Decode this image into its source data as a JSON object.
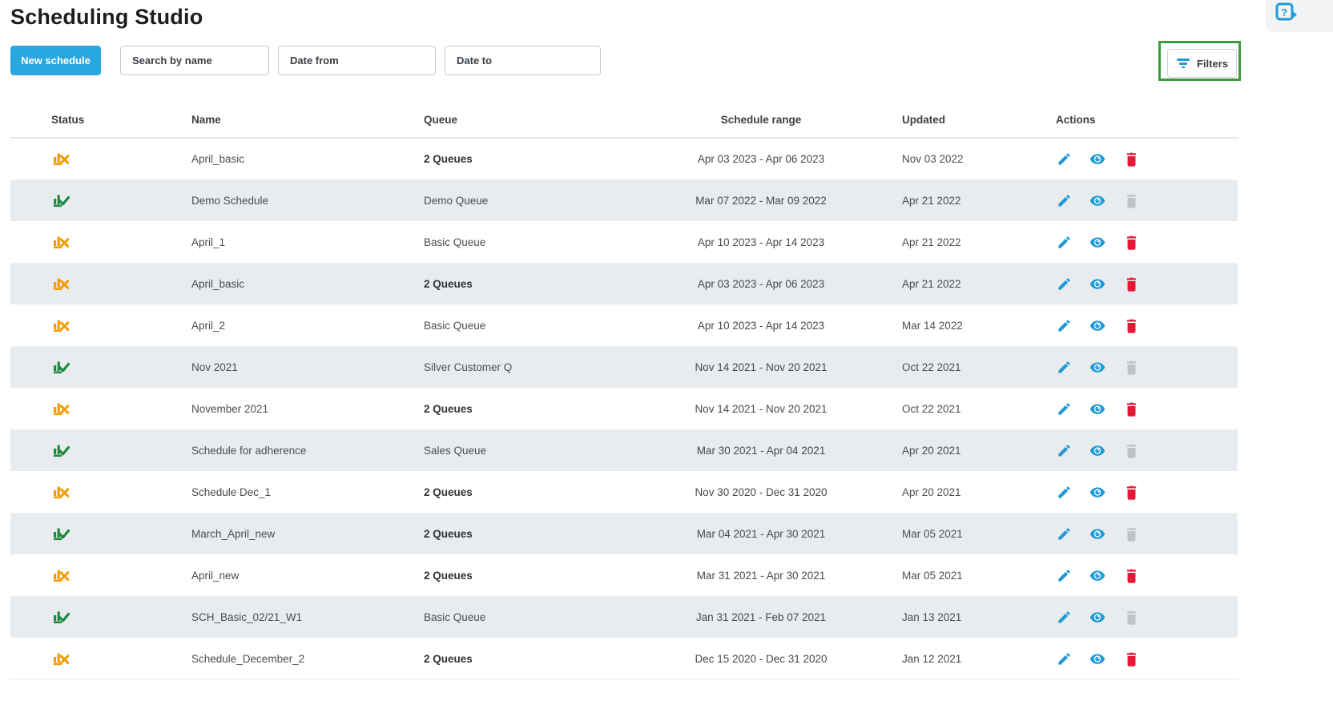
{
  "page": {
    "title": "Scheduling Studio"
  },
  "toolbar": {
    "new_schedule_label": "New schedule",
    "search_placeholder": "Search by name",
    "date_from_placeholder": "Date from",
    "date_to_placeholder": "Date to",
    "filters_label": "Filters"
  },
  "icons": {
    "help": "help-question-bubble-icon",
    "filter": "filter-lines-icon",
    "edit": "pencil-icon",
    "view": "eye-icon",
    "delete": "trash-icon",
    "status_published": "chart-check-icon",
    "status_unpublished": "chart-x-icon"
  },
  "colors": {
    "accent_blue": "#2BA7E0",
    "icon_blue": "#1F9AD7",
    "danger_red": "#E51937",
    "disabled_gray": "#BDC3C7",
    "status_orange": "#F59B00",
    "status_green": "#1F8A3E",
    "highlight_green": "#3D9A40",
    "row_alt_bg": "#E8ECEF"
  },
  "table": {
    "columns": [
      "Status",
      "Name",
      "Queue",
      "Schedule range",
      "Updated",
      "Actions"
    ],
    "rows": [
      {
        "status": "unpublished",
        "name": "April_basic",
        "queue": "2 Queues",
        "queue_bold": true,
        "range": "Apr 03 2023 - Apr 06 2023",
        "updated": "Nov 03 2022",
        "deletable": true
      },
      {
        "status": "published",
        "name": "Demo Schedule",
        "queue": "Demo Queue",
        "queue_bold": false,
        "range": "Mar 07 2022 - Mar 09 2022",
        "updated": "Apr 21 2022",
        "deletable": false
      },
      {
        "status": "unpublished",
        "name": "April_1",
        "queue": "Basic Queue",
        "queue_bold": false,
        "range": "Apr 10 2023 - Apr 14 2023",
        "updated": "Apr 21 2022",
        "deletable": true
      },
      {
        "status": "unpublished",
        "name": "April_basic",
        "queue": "2 Queues",
        "queue_bold": true,
        "range": "Apr 03 2023 - Apr 06 2023",
        "updated": "Apr 21 2022",
        "deletable": true
      },
      {
        "status": "unpublished",
        "name": "April_2",
        "queue": "Basic Queue",
        "queue_bold": false,
        "range": "Apr 10 2023 - Apr 14 2023",
        "updated": "Mar 14 2022",
        "deletable": true
      },
      {
        "status": "published",
        "name": "Nov 2021",
        "queue": "Silver Customer Q",
        "queue_bold": false,
        "range": "Nov 14 2021 - Nov 20 2021",
        "updated": "Oct 22 2021",
        "deletable": false
      },
      {
        "status": "unpublished",
        "name": "November 2021",
        "queue": "2 Queues",
        "queue_bold": true,
        "range": "Nov 14 2021 - Nov 20 2021",
        "updated": "Oct 22 2021",
        "deletable": true
      },
      {
        "status": "published",
        "name": "Schedule for adherence",
        "queue": "Sales Queue",
        "queue_bold": false,
        "range": "Mar 30 2021 - Apr 04 2021",
        "updated": "Apr 20 2021",
        "deletable": false
      },
      {
        "status": "unpublished",
        "name": "Schedule Dec_1",
        "queue": "2 Queues",
        "queue_bold": true,
        "range": "Nov 30 2020 - Dec 31 2020",
        "updated": "Apr 20 2021",
        "deletable": true
      },
      {
        "status": "published",
        "name": "March_April_new",
        "queue": "2 Queues",
        "queue_bold": true,
        "range": "Mar 04 2021 - Apr 30 2021",
        "updated": "Mar 05 2021",
        "deletable": false
      },
      {
        "status": "unpublished",
        "name": "April_new",
        "queue": "2 Queues",
        "queue_bold": true,
        "range": "Mar 31 2021 - Apr 30 2021",
        "updated": "Mar 05 2021",
        "deletable": true
      },
      {
        "status": "published",
        "name": "SCH_Basic_02/21_W1",
        "queue": "Basic Queue",
        "queue_bold": false,
        "range": "Jan 31 2021 - Feb 07 2021",
        "updated": "Jan 13 2021",
        "deletable": false
      },
      {
        "status": "unpublished",
        "name": "Schedule_December_2",
        "queue": "2 Queues",
        "queue_bold": true,
        "range": "Dec 15 2020 - Dec 31 2020",
        "updated": "Jan 12 2021",
        "deletable": true
      }
    ]
  }
}
